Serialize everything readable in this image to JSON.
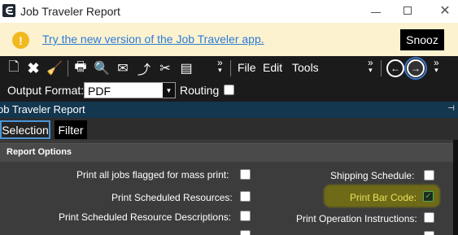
{
  "window": {
    "title": "Job Traveler Report"
  },
  "banner": {
    "message": "Try the new version of the Job Traveler app.",
    "snooze_label": "Snooz",
    "info_glyph": "!"
  },
  "toolbar": {
    "menu": [
      "File",
      "Edit",
      "Tools"
    ],
    "output_format_label": "Output Format:",
    "output_format_value": "PDF",
    "routing_label": "Routing",
    "routing_checked": false
  },
  "section": {
    "title": "ob Traveler Report"
  },
  "tabs": [
    {
      "label": "Selection",
      "selected": true
    },
    {
      "label": "Filter",
      "selected": false
    }
  ],
  "report_options": {
    "header": "Report Options",
    "left": [
      {
        "label": "Print all jobs flagged for mass print:",
        "checked": false
      },
      {
        "label": "Print Scheduled Resources:",
        "checked": false
      },
      {
        "label": "Print Scheduled Resource Descriptions:",
        "checked": false
      }
    ],
    "right": [
      {
        "label": "Shipping Schedule:",
        "checked": false
      },
      {
        "label": "Print Bar Code:",
        "checked": true
      },
      {
        "label": "Print Operation Instructions:",
        "checked": false
      }
    ]
  },
  "colors": {
    "accent": "#4c94d8",
    "banner_bg": "#fdf2cf",
    "link": "#2a7bd6",
    "section_bg": "#13374f",
    "highlight": "#6e6a18",
    "check": "#4caf50"
  }
}
